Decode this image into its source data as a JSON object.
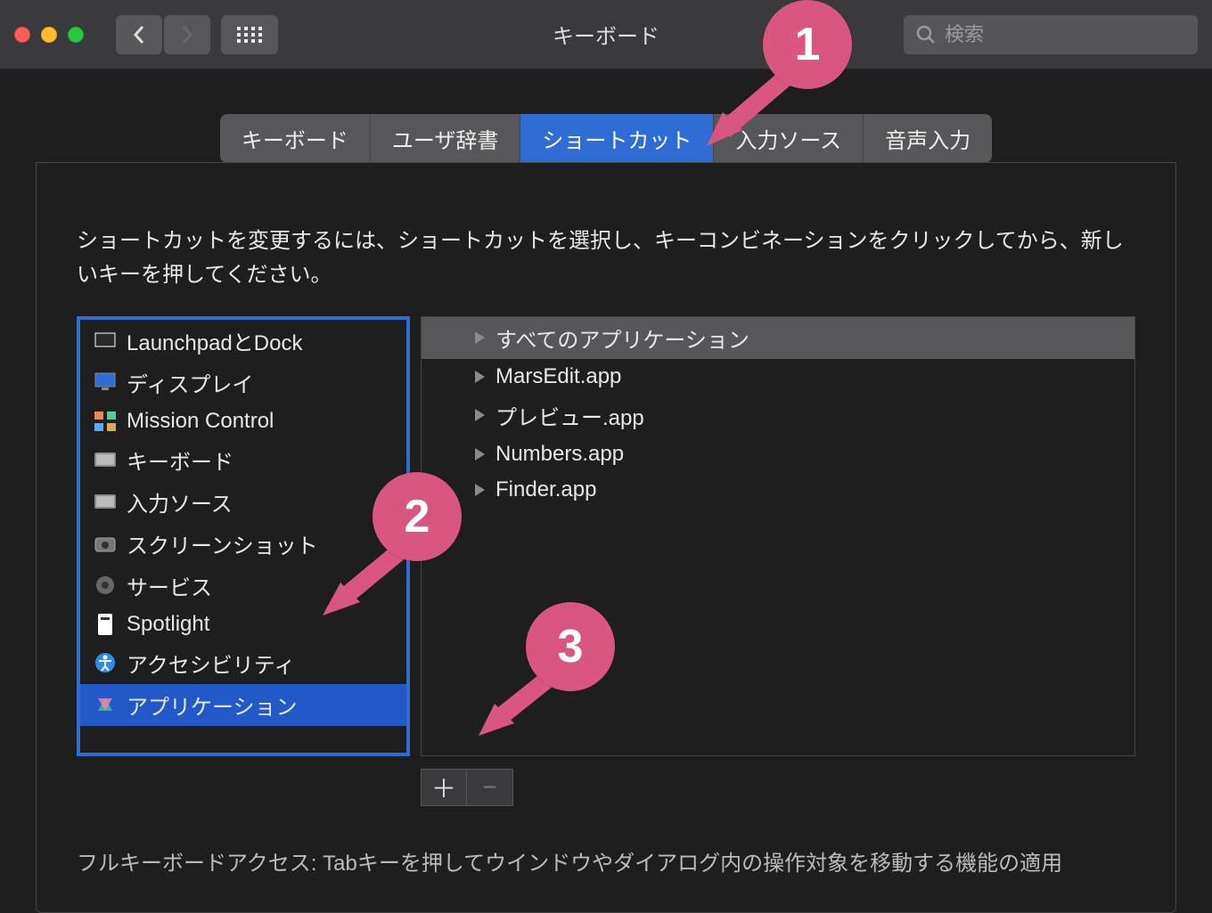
{
  "window": {
    "title": "キーボード",
    "search_placeholder": "検索"
  },
  "tabs": [
    {
      "label": "キーボード",
      "active": false
    },
    {
      "label": "ユーザ辞書",
      "active": false
    },
    {
      "label": "ショートカット",
      "active": true
    },
    {
      "label": "入力ソース",
      "active": false
    },
    {
      "label": "音声入力",
      "active": false
    }
  ],
  "help_text": "ショートカットを変更するには、ショートカットを選択し、キーコンビネーションをクリックしてから、新しいキーを押してください。",
  "categories": [
    {
      "icon": "launchpad-icon",
      "label": "LaunchpadとDock",
      "selected": false
    },
    {
      "icon": "display-icon",
      "label": "ディスプレイ",
      "selected": false
    },
    {
      "icon": "mission-control-icon",
      "label": "Mission Control",
      "selected": false
    },
    {
      "icon": "keyboard-icon",
      "label": "キーボード",
      "selected": false
    },
    {
      "icon": "keyboard-icon",
      "label": "入力ソース",
      "selected": false
    },
    {
      "icon": "screenshot-icon",
      "label": "スクリーンショット",
      "selected": false
    },
    {
      "icon": "services-icon",
      "label": "サービス",
      "selected": false
    },
    {
      "icon": "spotlight-icon",
      "label": "Spotlight",
      "selected": false
    },
    {
      "icon": "accessibility-icon",
      "label": "アクセシビリティ",
      "selected": false
    },
    {
      "icon": "app-icon",
      "label": "アプリケーション",
      "selected": true
    }
  ],
  "apps": [
    {
      "label": "すべてのアプリケーション",
      "selected": true
    },
    {
      "label": "MarsEdit.app",
      "selected": false
    },
    {
      "label": "プレビュー.app",
      "selected": false
    },
    {
      "label": "Numbers.app",
      "selected": false
    },
    {
      "label": "Finder.app",
      "selected": false
    }
  ],
  "buttons": {
    "add": "＋",
    "remove": "−"
  },
  "footer": "フルキーボードアクセス: Tabキーを押してウインドウやダイアログ内の操作対象を移動する機能の適用",
  "annotations": {
    "b1": "1",
    "b2": "2",
    "b3": "3"
  }
}
